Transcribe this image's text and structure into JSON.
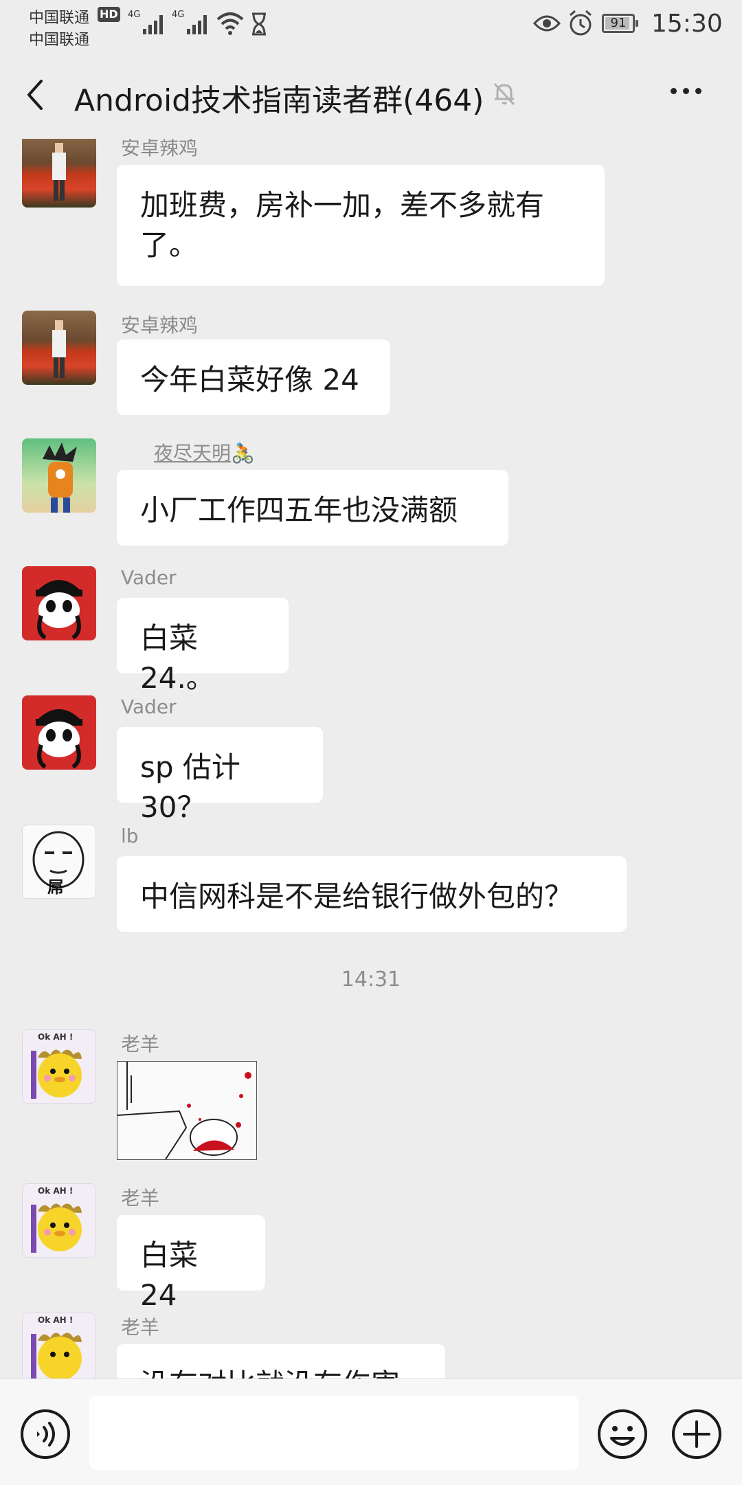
{
  "status_bar": {
    "carrier1": "中国联通",
    "carrier2": "中国联通",
    "hd": "HD",
    "net1": "4G",
    "net2": "4G",
    "battery": "91",
    "battery_level": 0.91,
    "time": "15:30"
  },
  "header": {
    "title": "Android技术指南读者群(464)",
    "icons": [
      "back-arrow-icon",
      "bell-muted-icon",
      "more-icon"
    ]
  },
  "messages": [
    {
      "sender": "安卓辣鸡",
      "text_line1": "加班费，房补一加，差不多就有",
      "text_line2": "了。"
    },
    {
      "sender": "安卓辣鸡",
      "text": "今年白菜好像 24"
    },
    {
      "sender": "夜尽天明",
      "sender_emoji": "🚴",
      "text": "小厂工作四五年也没满额"
    },
    {
      "sender": "Vader",
      "text": "白菜 24.。"
    },
    {
      "sender": "Vader",
      "text": "sp 估计 30？"
    },
    {
      "sender": "lb",
      "avatar_text": "屌",
      "text": "中信网科是不是给银行做外包的？"
    }
  ],
  "time_separator": "14:31",
  "messages_after": [
    {
      "sender": "老羊",
      "avatar_text": "Ok AH !",
      "type": "image"
    },
    {
      "sender": "老羊",
      "avatar_text": "Ok AH !",
      "text": "白菜 24"
    },
    {
      "sender": "老羊",
      "avatar_text": "Ok AH !",
      "text": "没有对比就没有伤害"
    }
  ],
  "input_bar": {
    "icons": [
      "voice-icon",
      "emoji-icon",
      "plus-icon"
    ]
  }
}
